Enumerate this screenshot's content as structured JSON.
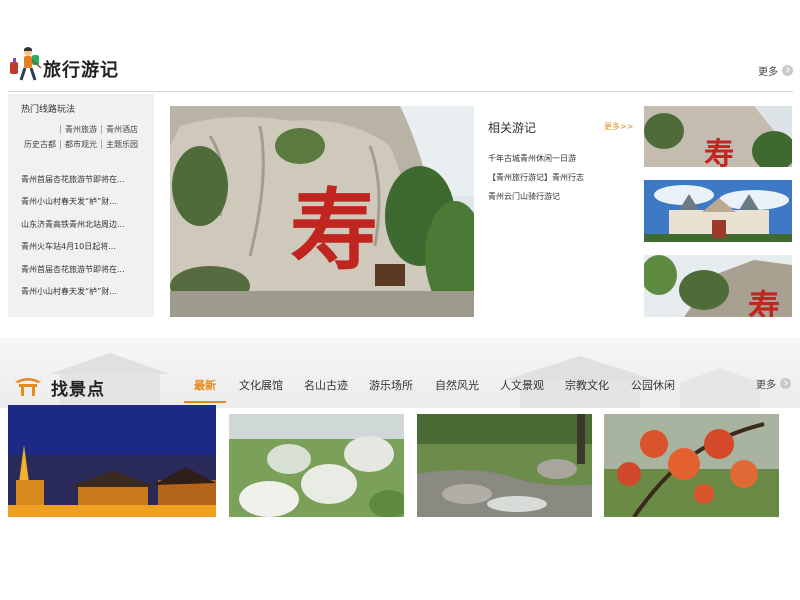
{
  "travel": {
    "title": "旅行游记",
    "more": "更多",
    "hot": {
      "title": "热门线路玩法",
      "tags_row1": [
        "青州旅游",
        "青州酒店"
      ],
      "tags_row2": [
        "历史古都",
        "都市观光",
        "主题乐园"
      ],
      "items": [
        "青州首届杏花旅游节即将在...",
        "青州小山村春天发“栌”财...",
        "山东济青高铁青州北站周边...",
        "青州火车站4月10日起将...",
        "青州首届杏花旅游节即将在...",
        "青州小山村春天发“栌”财..."
      ]
    },
    "related": {
      "title": "相关游记",
      "more": "更多>>",
      "items": [
        "千年古城青州休闲一日游",
        "【青州旅行游记】青州行志",
        "青州云门山骑行游记"
      ]
    }
  },
  "scenic": {
    "title": "找景点",
    "more": "更多",
    "active_tab": "最新",
    "tabs": [
      "最新",
      "文化展馆",
      "名山古迹",
      "游乐场所",
      "自然风光",
      "人文景观",
      "宗教文化",
      "公园休闲"
    ]
  },
  "colors": {
    "accent": "#e58a1e",
    "panel": "#f1f1f1",
    "divider": "#d9d9d9"
  },
  "icons": [
    "traveler-logo-icon",
    "more-arrow-icon",
    "pavilion-icon"
  ]
}
